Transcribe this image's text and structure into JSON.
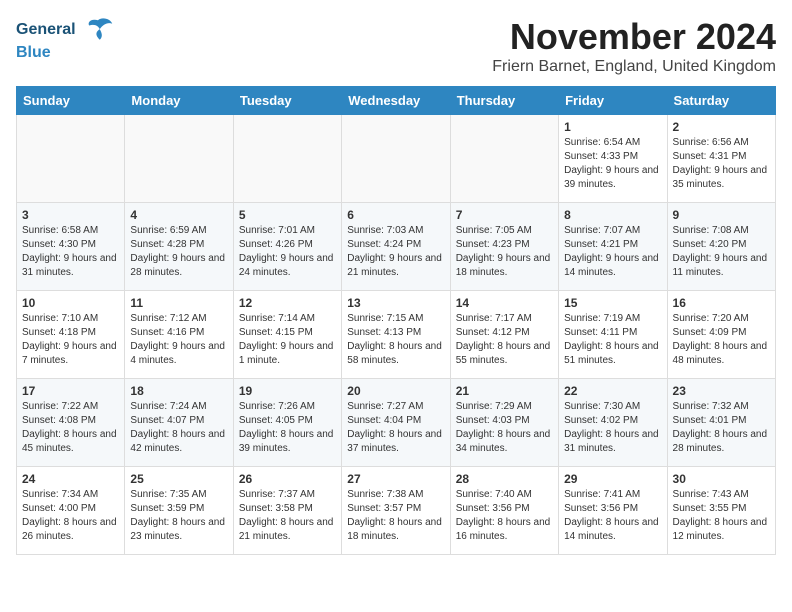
{
  "header": {
    "logo_line1": "General",
    "logo_line2": "Blue",
    "month_title": "November 2024",
    "location": "Friern Barnet, England, United Kingdom"
  },
  "weekdays": [
    "Sunday",
    "Monday",
    "Tuesday",
    "Wednesday",
    "Thursday",
    "Friday",
    "Saturday"
  ],
  "weeks": [
    [
      {
        "day": "",
        "content": ""
      },
      {
        "day": "",
        "content": ""
      },
      {
        "day": "",
        "content": ""
      },
      {
        "day": "",
        "content": ""
      },
      {
        "day": "",
        "content": ""
      },
      {
        "day": "1",
        "content": "Sunrise: 6:54 AM\nSunset: 4:33 PM\nDaylight: 9 hours and 39 minutes."
      },
      {
        "day": "2",
        "content": "Sunrise: 6:56 AM\nSunset: 4:31 PM\nDaylight: 9 hours and 35 minutes."
      }
    ],
    [
      {
        "day": "3",
        "content": "Sunrise: 6:58 AM\nSunset: 4:30 PM\nDaylight: 9 hours and 31 minutes."
      },
      {
        "day": "4",
        "content": "Sunrise: 6:59 AM\nSunset: 4:28 PM\nDaylight: 9 hours and 28 minutes."
      },
      {
        "day": "5",
        "content": "Sunrise: 7:01 AM\nSunset: 4:26 PM\nDaylight: 9 hours and 24 minutes."
      },
      {
        "day": "6",
        "content": "Sunrise: 7:03 AM\nSunset: 4:24 PM\nDaylight: 9 hours and 21 minutes."
      },
      {
        "day": "7",
        "content": "Sunrise: 7:05 AM\nSunset: 4:23 PM\nDaylight: 9 hours and 18 minutes."
      },
      {
        "day": "8",
        "content": "Sunrise: 7:07 AM\nSunset: 4:21 PM\nDaylight: 9 hours and 14 minutes."
      },
      {
        "day": "9",
        "content": "Sunrise: 7:08 AM\nSunset: 4:20 PM\nDaylight: 9 hours and 11 minutes."
      }
    ],
    [
      {
        "day": "10",
        "content": "Sunrise: 7:10 AM\nSunset: 4:18 PM\nDaylight: 9 hours and 7 minutes."
      },
      {
        "day": "11",
        "content": "Sunrise: 7:12 AM\nSunset: 4:16 PM\nDaylight: 9 hours and 4 minutes."
      },
      {
        "day": "12",
        "content": "Sunrise: 7:14 AM\nSunset: 4:15 PM\nDaylight: 9 hours and 1 minute."
      },
      {
        "day": "13",
        "content": "Sunrise: 7:15 AM\nSunset: 4:13 PM\nDaylight: 8 hours and 58 minutes."
      },
      {
        "day": "14",
        "content": "Sunrise: 7:17 AM\nSunset: 4:12 PM\nDaylight: 8 hours and 55 minutes."
      },
      {
        "day": "15",
        "content": "Sunrise: 7:19 AM\nSunset: 4:11 PM\nDaylight: 8 hours and 51 minutes."
      },
      {
        "day": "16",
        "content": "Sunrise: 7:20 AM\nSunset: 4:09 PM\nDaylight: 8 hours and 48 minutes."
      }
    ],
    [
      {
        "day": "17",
        "content": "Sunrise: 7:22 AM\nSunset: 4:08 PM\nDaylight: 8 hours and 45 minutes."
      },
      {
        "day": "18",
        "content": "Sunrise: 7:24 AM\nSunset: 4:07 PM\nDaylight: 8 hours and 42 minutes."
      },
      {
        "day": "19",
        "content": "Sunrise: 7:26 AM\nSunset: 4:05 PM\nDaylight: 8 hours and 39 minutes."
      },
      {
        "day": "20",
        "content": "Sunrise: 7:27 AM\nSunset: 4:04 PM\nDaylight: 8 hours and 37 minutes."
      },
      {
        "day": "21",
        "content": "Sunrise: 7:29 AM\nSunset: 4:03 PM\nDaylight: 8 hours and 34 minutes."
      },
      {
        "day": "22",
        "content": "Sunrise: 7:30 AM\nSunset: 4:02 PM\nDaylight: 8 hours and 31 minutes."
      },
      {
        "day": "23",
        "content": "Sunrise: 7:32 AM\nSunset: 4:01 PM\nDaylight: 8 hours and 28 minutes."
      }
    ],
    [
      {
        "day": "24",
        "content": "Sunrise: 7:34 AM\nSunset: 4:00 PM\nDaylight: 8 hours and 26 minutes."
      },
      {
        "day": "25",
        "content": "Sunrise: 7:35 AM\nSunset: 3:59 PM\nDaylight: 8 hours and 23 minutes."
      },
      {
        "day": "26",
        "content": "Sunrise: 7:37 AM\nSunset: 3:58 PM\nDaylight: 8 hours and 21 minutes."
      },
      {
        "day": "27",
        "content": "Sunrise: 7:38 AM\nSunset: 3:57 PM\nDaylight: 8 hours and 18 minutes."
      },
      {
        "day": "28",
        "content": "Sunrise: 7:40 AM\nSunset: 3:56 PM\nDaylight: 8 hours and 16 minutes."
      },
      {
        "day": "29",
        "content": "Sunrise: 7:41 AM\nSunset: 3:56 PM\nDaylight: 8 hours and 14 minutes."
      },
      {
        "day": "30",
        "content": "Sunrise: 7:43 AM\nSunset: 3:55 PM\nDaylight: 8 hours and 12 minutes."
      }
    ]
  ]
}
